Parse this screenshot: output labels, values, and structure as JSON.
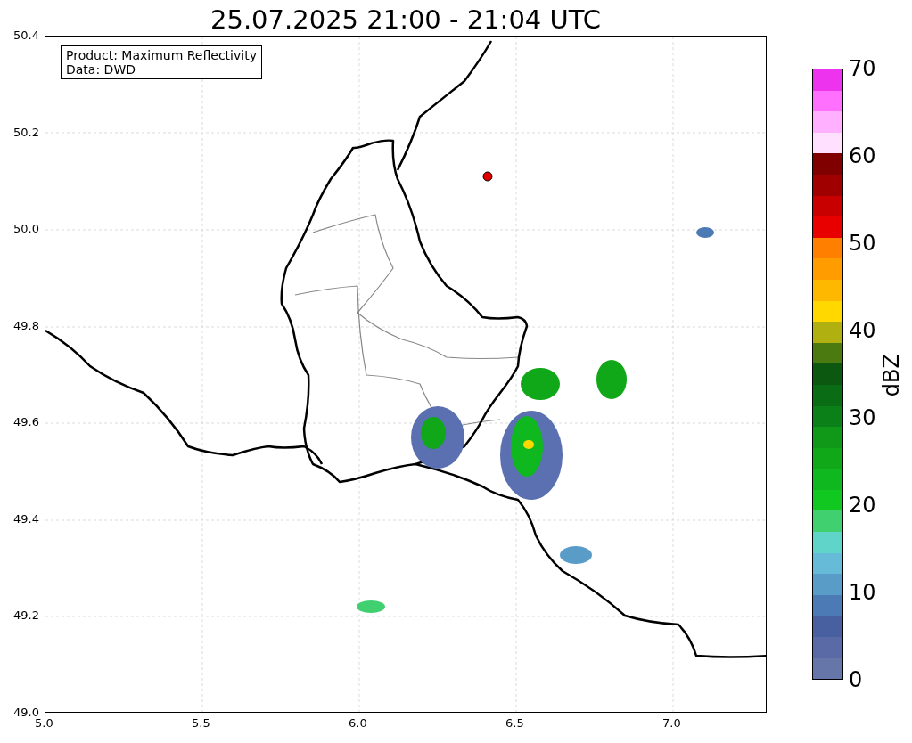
{
  "title": "25.07.2025 21:00 - 21:04 UTC",
  "legend": [
    "Product: Maximum Reflectivity",
    "Data: DWD"
  ],
  "x_ticks": [
    "5.0",
    "5.5",
    "6.0",
    "6.5",
    "7.0"
  ],
  "y_ticks": [
    "50.4",
    "50.2",
    "50.0",
    "49.8",
    "49.6",
    "49.4",
    "49.2",
    "49.0"
  ],
  "colorbar": {
    "label": "dBZ",
    "ticks": [
      "70",
      "60",
      "50",
      "40",
      "30",
      "20",
      "10",
      "0"
    ],
    "segments": [
      {
        "color": "#ee33ee"
      },
      {
        "color": "#ff70ff"
      },
      {
        "color": "#ffb0ff"
      },
      {
        "color": "#ffe0ff"
      },
      {
        "color": "#800000"
      },
      {
        "color": "#a00000"
      },
      {
        "color": "#c80000"
      },
      {
        "color": "#e80000"
      },
      {
        "color": "#ff8000"
      },
      {
        "color": "#ff9c00"
      },
      {
        "color": "#ffb800"
      },
      {
        "color": "#ffd800"
      },
      {
        "color": "#b0b010"
      },
      {
        "color": "#4a7a10"
      },
      {
        "color": "#0c5810"
      },
      {
        "color": "#0a6c14"
      },
      {
        "color": "#0c8018"
      },
      {
        "color": "#109818"
      },
      {
        "color": "#10a818"
      },
      {
        "color": "#10b820"
      },
      {
        "color": "#10c820"
      },
      {
        "color": "#40d070"
      },
      {
        "color": "#60d4c8"
      },
      {
        "color": "#66bcd8"
      },
      {
        "color": "#5a9cc8"
      },
      {
        "color": "#4c7ab4"
      },
      {
        "color": "#4860a0"
      },
      {
        "color": "#5a6aa6"
      },
      {
        "color": "#6676a8"
      }
    ]
  }
}
